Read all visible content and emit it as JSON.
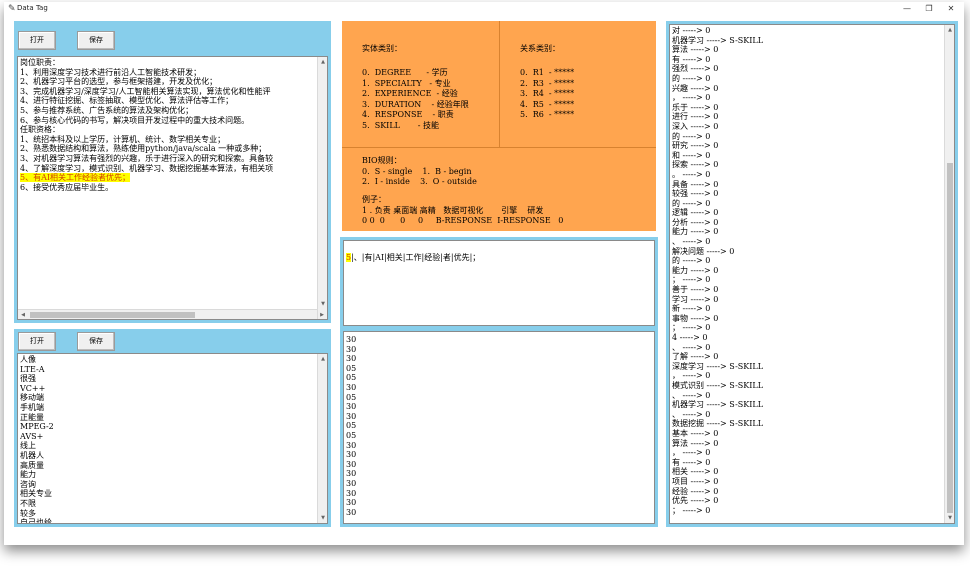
{
  "window": {
    "title": "Data Tag",
    "icon": "feather-icon"
  },
  "left_top": {
    "open_label": "打开",
    "save_label": "保存",
    "lines": [
      "岗位职责：",
      "1、利用深度学习技术进行前沿人工智能技术研发；",
      "2、机器学习平台的选型，参与框架搭建，开发及优化；",
      "3、完成机器学习/深度学习/人工智能相关算法实现，算法优化和性能评",
      "4、进行特征挖掘、标签抽取、模型优化、算法评估等工作；",
      "5、参与推荐系统、广告系统的算法及架构优化；",
      "6、参与核心代码的书写，解决项目开发过程中的重大技术问题。",
      "任职资格：",
      "1、统招本科及以上学历，计算机、统计、数学相关专业；",
      "2、熟悉数据结构和算法，熟练使用python/java/scala 一种或多种；",
      "3、对机器学习算法有强烈的兴趣，乐于进行深入的研究和探索。具备较",
      "4、了解深度学习，模式识别、机器学习、数据挖掘基本算法，有相关项",
      "5、有AI相关工作经验者优先；",
      "6、接受优秀应届毕业生。"
    ],
    "highlight_index": 12
  },
  "left_bottom": {
    "open_label": "打开",
    "save_label": "保存",
    "lines": [
      "人像",
      "LTE-A",
      "很强",
      "VC++",
      "移动端",
      "手机端",
      "正能量",
      "MPEG-2",
      "AVS+",
      "线上",
      "机器人",
      "高质量",
      "能力",
      "咨询",
      "相关专业",
      "不限",
      "较多",
      "自己也给"
    ]
  },
  "legend": {
    "entity_title": "实体类别：",
    "relation_title": "关系类别：",
    "entities": [
      "0.  DEGREE      - 学历",
      "1.  SPECIALTY   - 专业",
      "2.  EXPERIENCE  - 经验",
      "3.  DURATION    - 经验年限",
      "4.  RESPONSE    - 职责",
      "5.  SKILL       - 技能"
    ],
    "relations": [
      "0.  R1  - *****",
      "2.  R3  - *****",
      "3.  R4  - *****",
      "4.  R5  - *****",
      "5.  R6  - *****"
    ],
    "bio_lines": [
      "BIO规则：",
      "0.  S - single    1.  B - begin",
      "2.  I - inside    3.  O - outside"
    ],
    "example_lines": [
      "例子：",
      "1 . 负责 桌面端 高精   数据可视化       引擎    研发",
      "0 0  0      0     0     B-RESPONSE  I-RESPONSE   0"
    ]
  },
  "sentence": {
    "first": "5",
    "rest": "|、|有|AI|相关|工作|经验|者|优先|；"
  },
  "tags_lines": [
    "30",
    "30",
    "30",
    "05",
    "05",
    "30",
    "05",
    "30",
    "30",
    "05",
    "05",
    "30",
    "30",
    "30",
    "30",
    "30",
    "30",
    "30",
    "30"
  ],
  "right_lines": [
    "对 -----> 0",
    "机器学习 -----> S-SKILL",
    "算法 -----> 0",
    "有 -----> 0",
    "强烈 -----> 0",
    "的 -----> 0",
    "兴趣 -----> 0",
    "， -----> 0",
    "乐于 -----> 0",
    "进行 -----> 0",
    "深入 -----> 0",
    "的 -----> 0",
    "研究 -----> 0",
    "和 -----> 0",
    "探索 -----> 0",
    "。 -----> 0",
    "具备 -----> 0",
    "较强 -----> 0",
    "的 -----> 0",
    "逻辑 -----> 0",
    "分析 -----> 0",
    "能力 -----> 0",
    "、 -----> 0",
    "解决问题 -----> 0",
    "的 -----> 0",
    "能力 -----> 0",
    "； -----> 0",
    "善于 -----> 0",
    "学习 -----> 0",
    "新 -----> 0",
    "事物 -----> 0",
    "； -----> 0",
    "4 -----> 0",
    "、 -----> 0",
    "了解 -----> 0",
    "深度学习 -----> S-SKILL",
    "， -----> 0",
    "模式识别 -----> S-SKILL",
    "、 -----> 0",
    "机器学习 -----> S-SKILL",
    "、 -----> 0",
    "数据挖掘 -----> S-SKILL",
    "基本 -----> 0",
    "算法 -----> 0",
    "， -----> 0",
    "有 -----> 0",
    "相关 -----> 0",
    "项目 -----> 0",
    "经验 -----> 0",
    "优先 -----> 0",
    "； -----> 0"
  ],
  "colors": {
    "panel_blue": "#87ceeb",
    "legend_orange": "#ffa54f",
    "highlight": "#ffff00"
  }
}
